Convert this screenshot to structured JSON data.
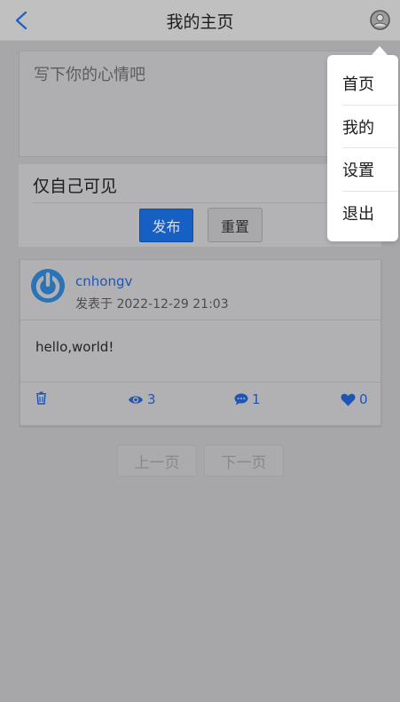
{
  "header": {
    "title": "我的主页"
  },
  "compose": {
    "placeholder": "写下你的心情吧",
    "visibility": "仅自己可见",
    "publish_label": "发布",
    "reset_label": "重置"
  },
  "post": {
    "author": "cnhongv",
    "time": "发表于 2022-12-29 21:03",
    "body": "hello,world!",
    "views": "3",
    "comments": "1",
    "likes": "0"
  },
  "pagination": {
    "prev_label": "上一页",
    "next_label": "下一页"
  },
  "menu": {
    "items": [
      "首页",
      "我的",
      "设置",
      "退出"
    ]
  },
  "colors": {
    "accent": "#1f56b5",
    "primary_button": "#1760c3",
    "background": "#a7a7a9"
  },
  "icons": [
    "back-chevron-icon",
    "user-avatar-icon",
    "power-avatar-icon",
    "trash-icon",
    "eye-icon",
    "comment-icon",
    "heart-icon"
  ]
}
